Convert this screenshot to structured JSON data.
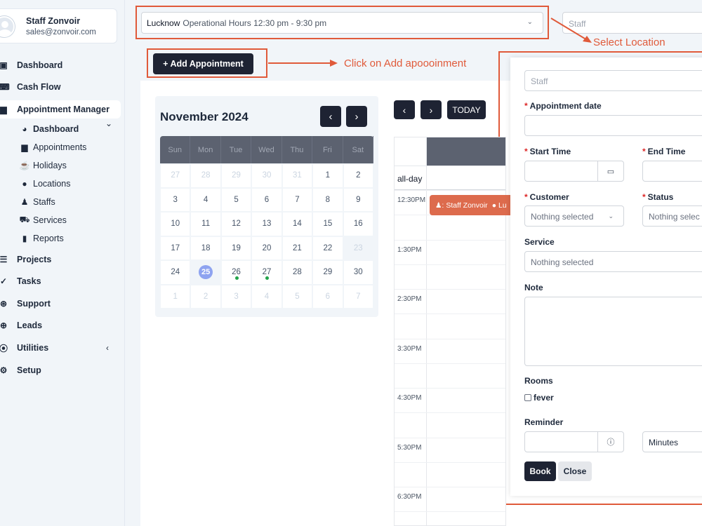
{
  "profile": {
    "name": "Staff Zonvoir",
    "email": "sales@zonvoir.com"
  },
  "sidebar": {
    "items": [
      {
        "label": "Dashboard",
        "icon": "dashboard-icon"
      },
      {
        "label": "Cash Flow",
        "icon": "keyboard-icon"
      },
      {
        "label": "Appointment Manager",
        "icon": "calendar-icon"
      },
      {
        "label": "Projects",
        "icon": "projects-icon"
      },
      {
        "label": "Tasks",
        "icon": "check-circle-icon"
      },
      {
        "label": "Support",
        "icon": "lifebuoy-icon"
      },
      {
        "label": "Leads",
        "icon": "crosshair-icon"
      },
      {
        "label": "Utilities",
        "icon": "dot-circle-icon"
      },
      {
        "label": "Setup",
        "icon": "gear-icon"
      }
    ],
    "sub_items": [
      {
        "label": "Dashboard",
        "icon": "palette-icon"
      },
      {
        "label": "Appointments",
        "icon": "calendar-icon"
      },
      {
        "label": "Holidays",
        "icon": "coffee-icon"
      },
      {
        "label": "Locations",
        "icon": "map-pin-icon"
      },
      {
        "label": "Staffs",
        "icon": "user-icon"
      },
      {
        "label": "Services",
        "icon": "car-icon"
      },
      {
        "label": "Reports",
        "icon": "file-icon"
      }
    ]
  },
  "topbar": {
    "location": "Lucknow",
    "hours": "Operational Hours 12:30 pm - 9:30 pm",
    "staff_placeholder": "Staff"
  },
  "annotations": {
    "select_location": "Select Location",
    "click_add": "Click on Add apoooinment"
  },
  "add_button": "+ Add Appointment",
  "mini_calendar": {
    "title": "November 2024",
    "weekdays": [
      "Sun",
      "Mon",
      "Tue",
      "Wed",
      "Thu",
      "Fri",
      "Sat"
    ],
    "days": [
      "27",
      "28",
      "29",
      "30",
      "31",
      "1",
      "2",
      "3",
      "4",
      "5",
      "6",
      "7",
      "8",
      "9",
      "10",
      "11",
      "12",
      "13",
      "14",
      "15",
      "16",
      "17",
      "18",
      "19",
      "20",
      "21",
      "22",
      "23",
      "24",
      "25",
      "26",
      "27",
      "28",
      "29",
      "30",
      "1",
      "2",
      "3",
      "4",
      "5",
      "6",
      "7"
    ],
    "today": "25",
    "event_days": [
      "26",
      "27"
    ]
  },
  "calendar": {
    "today_label": "TODAY",
    "allday_label": "all-day",
    "slots": [
      "12:30PM",
      "1:30PM",
      "2:30PM",
      "3:30PM",
      "4:30PM",
      "5:30PM",
      "6:30PM"
    ],
    "event": {
      "staff": "Staff Zonvoir",
      "location": "Lu",
      "color": "#dd6b4d"
    }
  },
  "form": {
    "staff_placeholder": "Staff",
    "date_label": "Appointment date",
    "start_label": "Start Time",
    "end_label": "End Time",
    "customer_label": "Customer",
    "customer_value": "Nothing selected",
    "status_label": "Status",
    "status_value": "Nothing selec",
    "service_label": "Service",
    "service_value": "Nothing selected",
    "note_label": "Note",
    "rooms_label": "Rooms",
    "room_option": "fever",
    "reminder_label": "Reminder",
    "reminder_unit": "Minutes",
    "book_label": "Book",
    "close_label": "Close"
  },
  "colors": {
    "accent": "#1e2333",
    "annotation": "#e05a3a"
  }
}
